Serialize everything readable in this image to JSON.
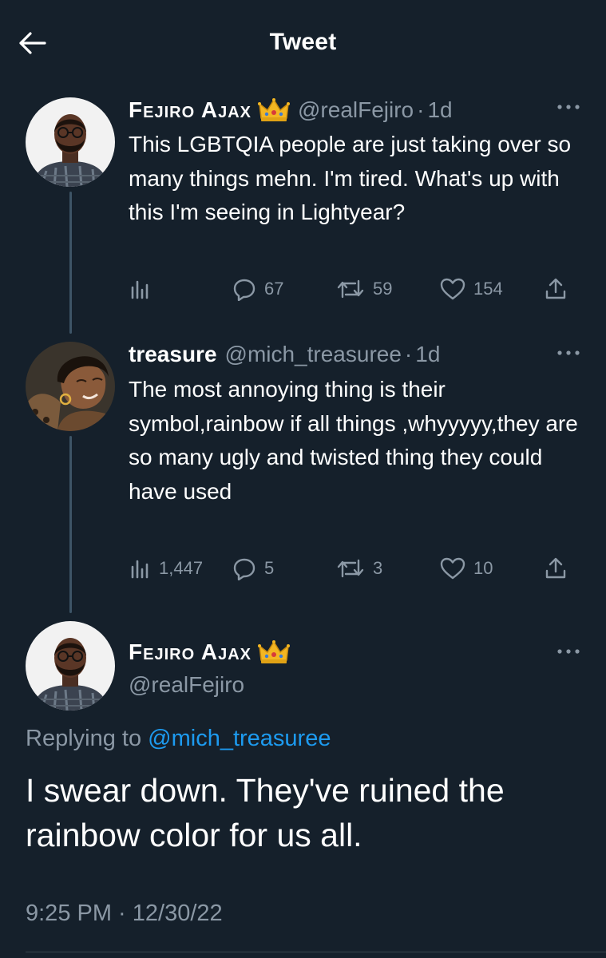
{
  "header": {
    "title": "Tweet",
    "back_icon": "arrow-left-icon"
  },
  "colors": {
    "background": "#15202b",
    "text": "#ffffff",
    "secondary": "#8b98a5",
    "link": "#1d9bf0",
    "thread_line": "#3d5466"
  },
  "thread": [
    {
      "name": "Fejiro Ajax",
      "badge": "crown-emoji",
      "handle": "@realFejiro",
      "separator": "·",
      "time": "1d",
      "text": "This LGBTQIA people are just taking over so many things mehn. I'm tired. What's up with this I'm seeing in Lightyear?",
      "views": "",
      "replies": "67",
      "retweets": "59",
      "likes": "154"
    },
    {
      "name": "treasure",
      "handle": "@mich_treasuree",
      "separator": "·",
      "time": "1d",
      "text": "The most annoying thing is their symbol,rainbow if all things ,whyyyyy,they are so many ugly and twisted thing they could have used",
      "views": "1,447",
      "replies": "5",
      "retweets": "3",
      "likes": "10"
    }
  ],
  "main_tweet": {
    "name": "Fejiro Ajax",
    "badge": "crown-emoji",
    "handle": "@realFejiro",
    "replying_prefix": "Replying to",
    "replying_to": "@mich_treasuree",
    "text": "I swear down. They've ruined the rainbow color for us all.",
    "timestamp": "9:25 PM · 12/30/22"
  }
}
